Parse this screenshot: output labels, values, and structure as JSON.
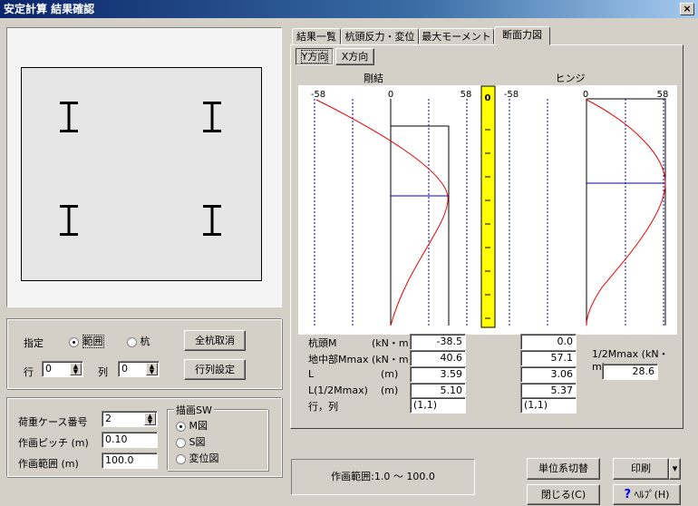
{
  "window": {
    "title": "安定計算  結果確認",
    "close": "×"
  },
  "tabs": [
    {
      "label": "結果一覧"
    },
    {
      "label": "杭頭反力・変位"
    },
    {
      "label": "最大モーメント"
    },
    {
      "label": "断面力図"
    }
  ],
  "subtabs": [
    {
      "label": "Y方向"
    },
    {
      "label": "X方向"
    }
  ],
  "diagram": {
    "left_title": "剛結",
    "right_title": "ヒンジ",
    "tick_min": "-58",
    "tick_zero": "0",
    "tick_max": "58",
    "depth_scale_top": "0"
  },
  "results": {
    "rows": [
      {
        "label": "杭頭M",
        "unit": "(kN・m)",
        "left": "-38.5",
        "right": "0.0"
      },
      {
        "label": "地中部Mmax",
        "unit": "(kN・m)",
        "left": "40.6",
        "right": "57.1"
      },
      {
        "label": "L",
        "unit": "(m)",
        "left": "3.59",
        "right": "3.06"
      },
      {
        "label": "L(1/2Mmax)",
        "unit": "(m)",
        "left": "5.10",
        "right": "5.37"
      },
      {
        "label": "行，列",
        "unit": "",
        "left": "(1,1)",
        "right": "(1,1)"
      }
    ],
    "half_mmax_label": "1/2Mmax (kN・m)",
    "half_mmax_value": "28.6"
  },
  "designation": {
    "label": "指定",
    "opt_range": "範囲",
    "opt_pile": "杭",
    "clear_all": "全杭取消",
    "row_label": "行",
    "row_value": "0",
    "col_label": "列",
    "col_value": "0",
    "set_rowcol": "行列設定"
  },
  "load": {
    "case_label": "荷重ケース番号",
    "case_value": "2",
    "pitch_label": "作画ピッチ (m)",
    "pitch_value": "0.10",
    "range_label": "作画範囲 (m)",
    "range_value": "100.0",
    "sw_label": "描画SW",
    "sw_m": "M図",
    "sw_s": "S図",
    "sw_disp": "変位図"
  },
  "status": {
    "text": "作画範囲:1.0 ～ 100.0"
  },
  "buttons": {
    "unit_switch": "単位系切替",
    "print": "印刷",
    "print_menu": "▾",
    "close": "閉じる(C)",
    "help": "ﾍﾙﾌﾟ(H)",
    "help_icon": "?"
  }
}
